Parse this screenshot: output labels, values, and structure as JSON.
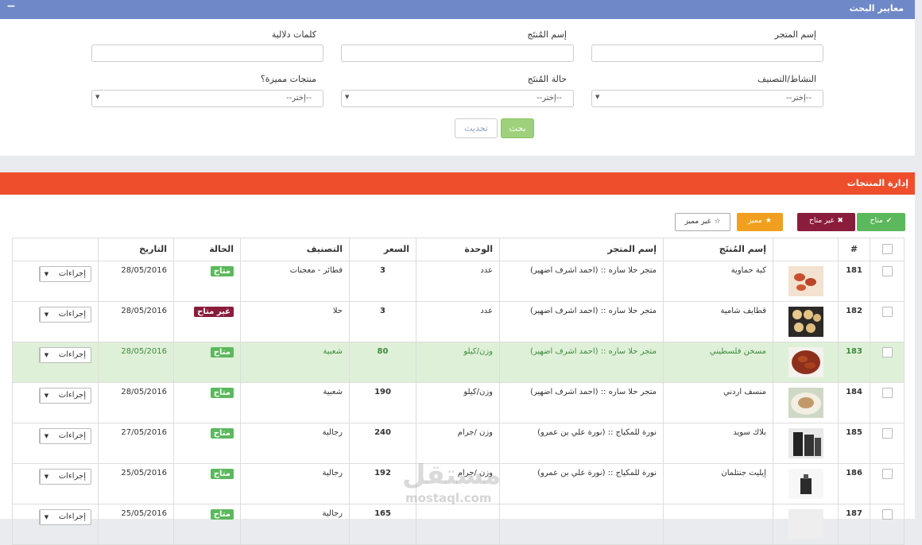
{
  "search_panel": {
    "title": "معايير البحث",
    "collapse_symbol": "−",
    "fields": {
      "store_name_label": "إسم المتجر",
      "product_name_label": "إسم المُنتَج",
      "keywords_label": "كلمات دلالية",
      "activity_label": "النشاط/التصنيف",
      "product_status_label": "حالة المُنتَج",
      "featured_label": "منتجات مميزة؟",
      "select_placeholder": "--إختر--"
    },
    "search_button": "بحث",
    "reset_button": "تحديث"
  },
  "products_panel": {
    "title": "إدارة المنتجات",
    "toolbar": {
      "available": "متاح",
      "unavailable": "غير متاح",
      "featured": "مميز",
      "not_featured": "غير مميز"
    },
    "columns": {
      "num": "#",
      "product_name": "إسم المُنتَج",
      "store_name": "إسم المتجر",
      "unit": "الوحدة",
      "price": "السعر",
      "category": "التصنيف",
      "status": "الحالة",
      "date": "التاريخ"
    },
    "action_label": "إجراءات",
    "rows": [
      {
        "id": "181",
        "name": "كبة حماوية",
        "store": "متجر حلا ساره :: (احمد اشرف اضهير)",
        "unit": "عدد",
        "price": "3",
        "category": "فطائر - معجنات",
        "status": "متاح",
        "date": "28/05/2016"
      },
      {
        "id": "182",
        "name": "قطايف شامية",
        "store": "متجر حلا ساره :: (احمد اشرف اضهير)",
        "unit": "عدد",
        "price": "3",
        "category": "حلا",
        "status": "غير متاح",
        "date": "28/05/2016"
      },
      {
        "id": "183",
        "name": "مسخن فلسطيني",
        "store": "متجر حلا ساره :: (احمد اشرف اضهير)",
        "unit": "وزن/كيلو",
        "price": "80",
        "category": "شعبية",
        "status": "متاح",
        "date": "28/05/2016"
      },
      {
        "id": "184",
        "name": "منسف اردني",
        "store": "متجر حلا ساره :: (احمد اشرف اضهير)",
        "unit": "وزن/كيلو",
        "price": "190",
        "category": "شعبية",
        "status": "متاح",
        "date": "28/05/2016"
      },
      {
        "id": "185",
        "name": "بلاك سويد",
        "store": "نورة للمكياج :: (نورة علي بن عمرو)",
        "unit": "وزن /جرام",
        "price": "240",
        "category": "رجالية",
        "status": "متاح",
        "date": "27/05/2016"
      },
      {
        "id": "186",
        "name": "إيليت جنتلمان",
        "store": "نورة للمكياج :: (نورة علي بن عمرو)",
        "unit": "وزن /جرام",
        "price": "192",
        "category": "رجالية",
        "status": "متاح",
        "date": "25/05/2016"
      },
      {
        "id": "187",
        "name": "",
        "store": "",
        "unit": "",
        "price": "165",
        "category": "رجالية",
        "status": "متاح",
        "date": "25/05/2016"
      }
    ]
  },
  "watermark": {
    "arabic": "مستقل",
    "latin": "mostaql.com"
  },
  "colors": {
    "search_header": "#6f88c7",
    "products_header": "#ee4e2b",
    "available": "#5cb85c",
    "unavailable": "#8a1c3c",
    "featured": "#f0a01e",
    "highlight_row": "#dff0d8"
  }
}
